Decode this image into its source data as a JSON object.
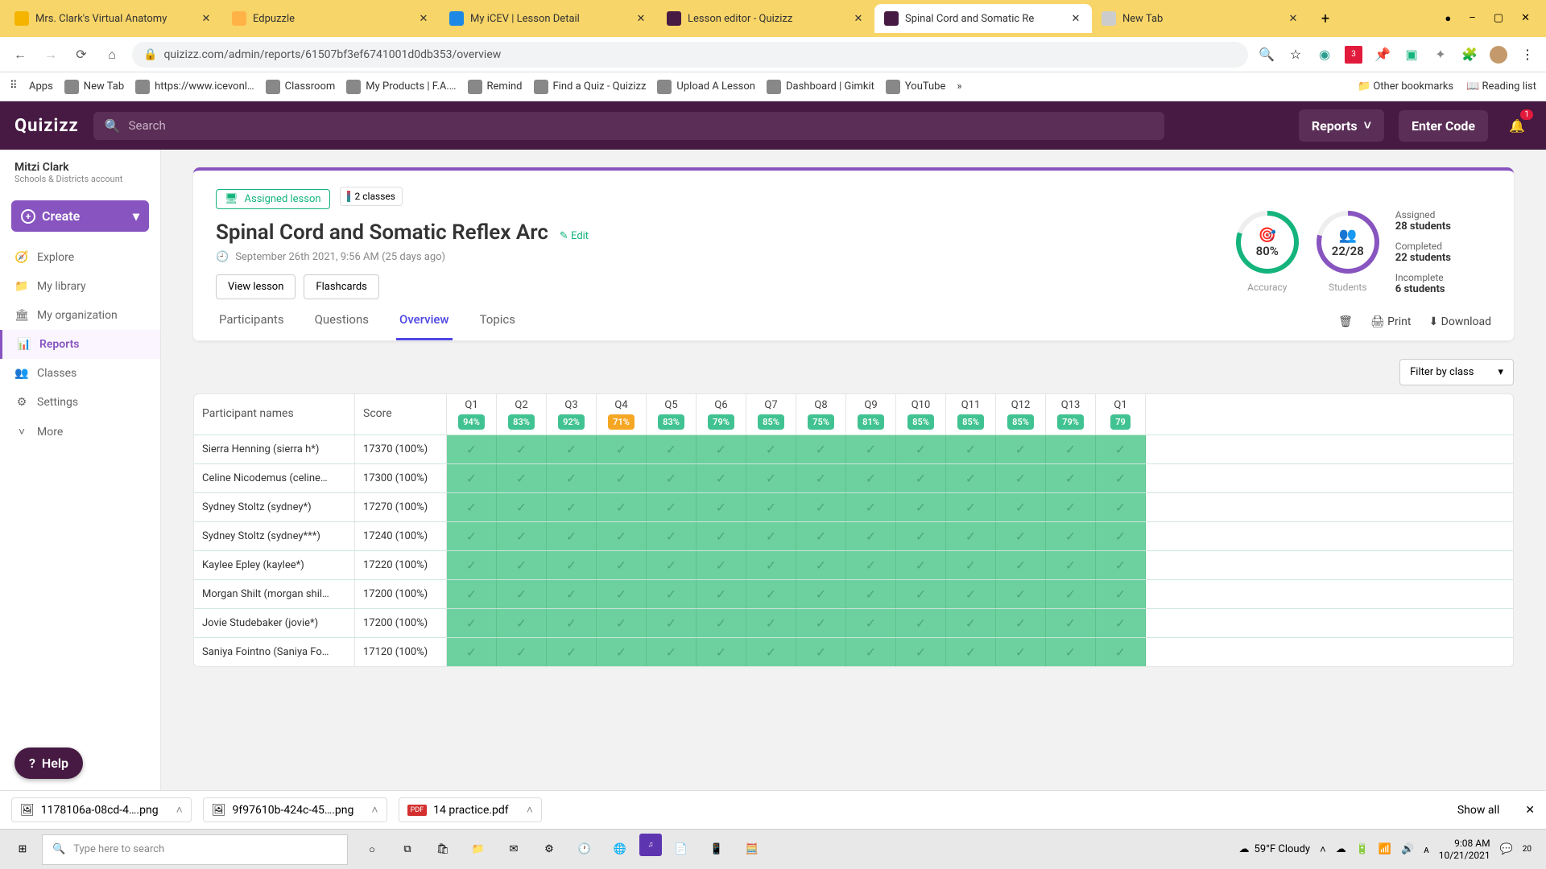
{
  "browser": {
    "tabs": [
      {
        "title": "Mrs. Clark's Virtual Anatomy",
        "favicon": "slides"
      },
      {
        "title": "Edpuzzle",
        "favicon": "ed"
      },
      {
        "title": "My iCEV | Lesson Detail",
        "favicon": "cev"
      },
      {
        "title": "Lesson editor - Quizizz",
        "favicon": "qz"
      },
      {
        "title": "Spinal Cord and Somatic Re",
        "favicon": "qz",
        "active": true
      },
      {
        "title": "New Tab",
        "favicon": "gray"
      }
    ],
    "url": "quizizz.com/admin/reports/61507bf3ef6741001d0db353/overview"
  },
  "bookmarks": [
    {
      "label": "Apps"
    },
    {
      "label": "New Tab"
    },
    {
      "label": "https://www.icevonl…"
    },
    {
      "label": "Classroom"
    },
    {
      "label": "My Products | F.A.…"
    },
    {
      "label": "Remind"
    },
    {
      "label": "Find a Quiz - Quizizz"
    },
    {
      "label": "Upload A Lesson"
    },
    {
      "label": "Dashboard | Gimkit"
    },
    {
      "label": "YouTube"
    }
  ],
  "bookmarks_right": {
    "other": "Other bookmarks",
    "reading": "Reading list"
  },
  "header": {
    "logo": "Quizizz",
    "search_placeholder": "Search",
    "reports": "Reports",
    "entercode": "Enter Code",
    "bell_badge": "1"
  },
  "sidebar": {
    "user": {
      "name": "Mitzi Clark",
      "role": "Schools & Districts account"
    },
    "create": "Create",
    "items": [
      {
        "label": "Explore",
        "icon": "🧭"
      },
      {
        "label": "My library",
        "icon": "📁"
      },
      {
        "label": "My organization",
        "icon": "🏛"
      },
      {
        "label": "Reports",
        "icon": "📊",
        "active": true
      },
      {
        "label": "Classes",
        "icon": "👥"
      },
      {
        "label": "Settings",
        "icon": "⚙"
      },
      {
        "label": "More",
        "icon": "˅"
      }
    ]
  },
  "lesson": {
    "tag": "Assigned lesson",
    "classes": "2 classes",
    "title": "Spinal Cord and Somatic Reflex Arc",
    "edit": "Edit",
    "timestamp": "September 26th 2021, 9:56 AM (25 days ago)",
    "view": "View lesson",
    "flash": "Flashcards"
  },
  "stats": {
    "accuracy": {
      "value": "80%",
      "label": "Accuracy",
      "pct": 80
    },
    "students": {
      "value": "22/28",
      "label": "Students",
      "pct": 79
    },
    "assigned_lbl": "Assigned",
    "assigned_val": "28 students",
    "completed_lbl": "Completed",
    "completed_val": "22 students",
    "incomplete_lbl": "Incomplete",
    "incomplete_val": "6 students"
  },
  "tabs": {
    "items": [
      "Participants",
      "Questions",
      "Overview",
      "Topics"
    ],
    "active": 2,
    "print": "Print",
    "download": "Download"
  },
  "filter": "Filter by class",
  "table": {
    "name_hdr": "Participant names",
    "score_hdr": "Score",
    "questions": [
      {
        "q": "Q1",
        "p": "94%"
      },
      {
        "q": "Q2",
        "p": "83%"
      },
      {
        "q": "Q3",
        "p": "92%"
      },
      {
        "q": "Q4",
        "p": "71%",
        "warn": true
      },
      {
        "q": "Q5",
        "p": "83%"
      },
      {
        "q": "Q6",
        "p": "79%"
      },
      {
        "q": "Q7",
        "p": "85%"
      },
      {
        "q": "Q8",
        "p": "75%"
      },
      {
        "q": "Q9",
        "p": "81%"
      },
      {
        "q": "Q10",
        "p": "85%"
      },
      {
        "q": "Q11",
        "p": "85%"
      },
      {
        "q": "Q12",
        "p": "85%"
      },
      {
        "q": "Q13",
        "p": "79%"
      },
      {
        "q": "Q1",
        "p": "79"
      }
    ],
    "rows": [
      {
        "name": "Sierra Henning (sierra h*)",
        "score": "17370 (100%)"
      },
      {
        "name": "Celine Nicodemus (celine…",
        "score": "17300 (100%)"
      },
      {
        "name": "Sydney Stoltz (sydney*)",
        "score": "17270 (100%)"
      },
      {
        "name": "Sydney Stoltz (sydney***)",
        "score": "17240 (100%)"
      },
      {
        "name": "Kaylee Epley (kaylee*)",
        "score": "17220 (100%)"
      },
      {
        "name": "Morgan Shilt (morgan shil…",
        "score": "17200 (100%)"
      },
      {
        "name": "Jovie Studebaker (jovie*)",
        "score": "17200 (100%)"
      },
      {
        "name": "Saniya Fointno (Saniya Fo…",
        "score": "17120 (100%)"
      }
    ]
  },
  "help": "Help",
  "downloads": [
    {
      "name": "1178106a-08cd-4….png",
      "type": "img"
    },
    {
      "name": "9f97610b-424c-45….png",
      "type": "img"
    },
    {
      "name": "14 practice.pdf",
      "type": "pdf"
    }
  ],
  "dl_showall": "Show all",
  "taskbar": {
    "search_placeholder": "Type here to search",
    "weather": "59°F  Cloudy",
    "time": "9:08 AM",
    "date": "10/21/2021",
    "notif": "20"
  }
}
